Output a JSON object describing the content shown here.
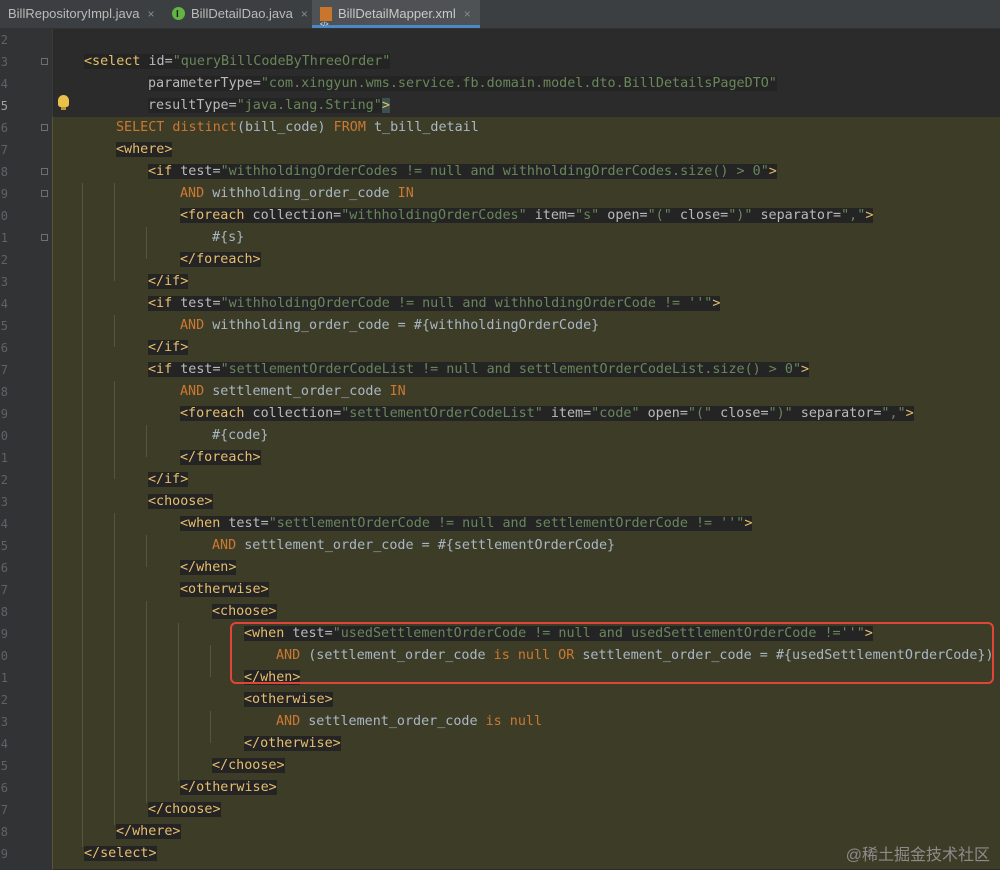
{
  "tabs": [
    {
      "label": "BillRepositoryImpl.java",
      "close": "×"
    },
    {
      "label": "BillDetailDao.java",
      "close": "×"
    },
    {
      "label": "BillDetailMapper.xml",
      "close": "×"
    }
  ],
  "line_numbers": [
    "2",
    "3",
    "4",
    "5",
    "6",
    "7",
    "8",
    "9",
    "0",
    "1",
    "2",
    "3",
    "4",
    "5",
    "6",
    "7",
    "8",
    "9",
    "0",
    "1",
    "2",
    "3",
    "4",
    "5",
    "6",
    "7",
    "8",
    "9",
    "0",
    "1",
    "2",
    "3",
    "4",
    "5",
    "6",
    "7",
    "8",
    "9",
    "0"
  ],
  "code": {
    "l3a": "<select",
    "l3b": " id=",
    "l3c": "\"queryBillCodeByThreeOrder\"",
    "l4a": "parameterType=",
    "l4b": "\"com.xingyun.wms.service.fb.domain.model.dto.BillDetailsPageDTO\"",
    "l5a": "resultType=",
    "l5b": "\"java.lang.String\"",
    "l5c": ">",
    "l6a": "SELECT distinct",
    "l6b": "(bill_code)",
    "l6c": " FROM",
    "l6d": " t_bill_detail",
    "l7": "<where>",
    "l8a": "<if",
    "l8b": " test=",
    "l8c": "\"withholdingOrderCodes != null and withholdingOrderCodes.size() > 0\"",
    "l8d": ">",
    "l9a": "AND",
    "l9b": " withholding_order_code ",
    "l9c": "IN",
    "l10a": "<foreach",
    "l10b": " collection=",
    "l10c": "\"withholdingOrderCodes\"",
    "l10d": " item=",
    "l10e": "\"s\"",
    "l10f": " open=",
    "l10g": "\"(\"",
    "l10h": " close=",
    "l10i": "\")\"",
    "l10j": " separator=",
    "l10k": "\",\"",
    "l10l": ">",
    "l11": "#{s}",
    "l12": "</foreach>",
    "l13": "</if>",
    "l14a": "<if",
    "l14b": " test=",
    "l14c": "\"withholdingOrderCode != null and withholdingOrderCode != ''\"",
    "l14d": ">",
    "l15a": "AND",
    "l15b": " withholding_order_code = #{withholdingOrderCode}",
    "l16": "</if>",
    "l17a": "<if",
    "l17b": " test=",
    "l17c": "\"settlementOrderCodeList != null and settlementOrderCodeList.size() > 0\"",
    "l17d": ">",
    "l18a": "AND",
    "l18b": " settlement_order_code ",
    "l18c": "IN",
    "l19a": "<foreach",
    "l19b": " collection=",
    "l19c": "\"settlementOrderCodeList\"",
    "l19d": " item=",
    "l19e": "\"code\"",
    "l19f": " open=",
    "l19g": "\"(\"",
    "l19h": " close=",
    "l19i": "\")\"",
    "l19j": " separator=",
    "l19k": "\",\"",
    "l19l": ">",
    "l20": "#{code}",
    "l21": "</foreach>",
    "l22": "</if>",
    "l23": "<choose>",
    "l24a": "<when",
    "l24b": " test=",
    "l24c": "\"settlementOrderCode != null and settlementOrderCode != ''\"",
    "l24d": ">",
    "l25a": "AND",
    "l25b": " settlement_order_code = #{settlementOrderCode}",
    "l26": "</when>",
    "l27": "<otherwise>",
    "l28": "<choose>",
    "l29a": "<when",
    "l29b": " test=",
    "l29c": "\"usedSettlementOrderCode != null and usedSettlementOrderCode !=''\"",
    "l29d": ">",
    "l30a": "AND",
    "l30b": " (settlement_order_code ",
    "l30c": "is null OR",
    "l30d": " settlement_order_code = #{usedSettlementOrderCode})",
    "l31": "</when>",
    "l32": "<otherwise>",
    "l33a": "AND",
    "l33b": " settlement_order_code ",
    "l33c": "is null",
    "l34": "</otherwise>",
    "l35": "</choose>",
    "l36": "</otherwise>",
    "l37": "</choose>",
    "l38": "</where>",
    "l39": "</select>"
  },
  "watermark": "@稀土掘金技术社区",
  "colors": {
    "tag": "#e8bf6a",
    "keyword": "#cc7832",
    "string": "#6a8759",
    "highlight_box": "#e0453a"
  }
}
